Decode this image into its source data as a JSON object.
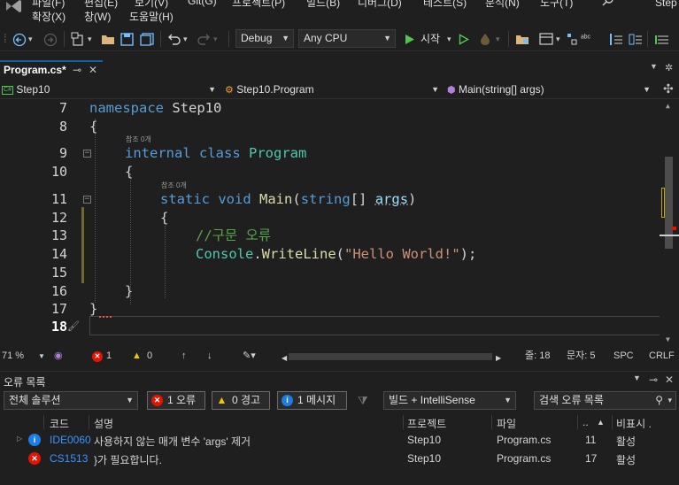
{
  "menu": {
    "row1_partial": [
      "파일(F)",
      "편집(E)",
      "보기(V)",
      "Git(G)",
      "프로젝트(P)",
      "빌드(B)",
      "디버그(D)",
      "테스트(S)",
      "분석(N)",
      "도구(T)"
    ],
    "items": [
      "확장(X)",
      "창(W)",
      "도움말(H)"
    ],
    "search_icon": "search-icon",
    "window_title_partial": "Step"
  },
  "toolbar": {
    "config": "Debug",
    "platform": "Any CPU",
    "start_label": "시작"
  },
  "tab": {
    "title": "Program.cs*",
    "pin": "⊸",
    "close": "✕"
  },
  "navbar": {
    "project": "Step10",
    "class": "Step10.Program",
    "member": "Main(string[] args)"
  },
  "editor": {
    "codelens": "참조 0개",
    "lines": [
      {
        "n": "7"
      },
      {
        "n": "8"
      },
      {
        "n": "9"
      },
      {
        "n": "10"
      },
      {
        "n": "11"
      },
      {
        "n": "12"
      },
      {
        "n": "13"
      },
      {
        "n": "14"
      },
      {
        "n": "15"
      },
      {
        "n": "16"
      },
      {
        "n": "17"
      },
      {
        "n": "18"
      }
    ],
    "code": {
      "namespace_kw": "namespace",
      "namespace_name": "Step10",
      "open_brace": "{",
      "close_brace": "}",
      "internal_kw": "internal",
      "class_kw": "class",
      "class_name": "Program",
      "static_kw": "static",
      "void_kw": "void",
      "main_name": "Main",
      "lparen": "(",
      "string_kw": "string",
      "arr": "[]",
      "args": "args",
      "rparen": ")",
      "comment": "//구문 오류",
      "console": "Console",
      "dot": ".",
      "writeline": "WriteLine",
      "hello": "\"Hello World!\"",
      "semi": ");"
    }
  },
  "status": {
    "zoom": "71 %",
    "errors": "1",
    "warnings": "0",
    "line": "줄: 18",
    "col": "문자: 5",
    "spc": "SPC",
    "crlf": "CRLF"
  },
  "error_list": {
    "title": "오류 목록",
    "scope": "전체 솔루션",
    "errors_btn": "1 오류",
    "warnings_btn": "0 경고",
    "messages_btn": "1 메시지",
    "source": "빌드 + IntelliSense",
    "search_placeholder": "검색 오류 목록",
    "columns": {
      "code": "코드",
      "desc": "설명",
      "project": "프로젝트",
      "file": "파일",
      "line": "..",
      "suppress": "비표시 ."
    },
    "rows": [
      {
        "type": "info",
        "code": "IDE0060",
        "desc": "사용하지 않는 매개 변수 'args' 제거",
        "project": "Step10",
        "file": "Program.cs",
        "line": "11",
        "state": "활성"
      },
      {
        "type": "error",
        "code": "CS1513",
        "desc": "}가 필요합니다.",
        "project": "Step10",
        "file": "Program.cs",
        "line": "17",
        "state": "활성"
      }
    ]
  },
  "colors": {
    "accent": "#0e639c",
    "error": "#e51400",
    "info": "#1c7ce8",
    "warning": "#f0c800"
  }
}
